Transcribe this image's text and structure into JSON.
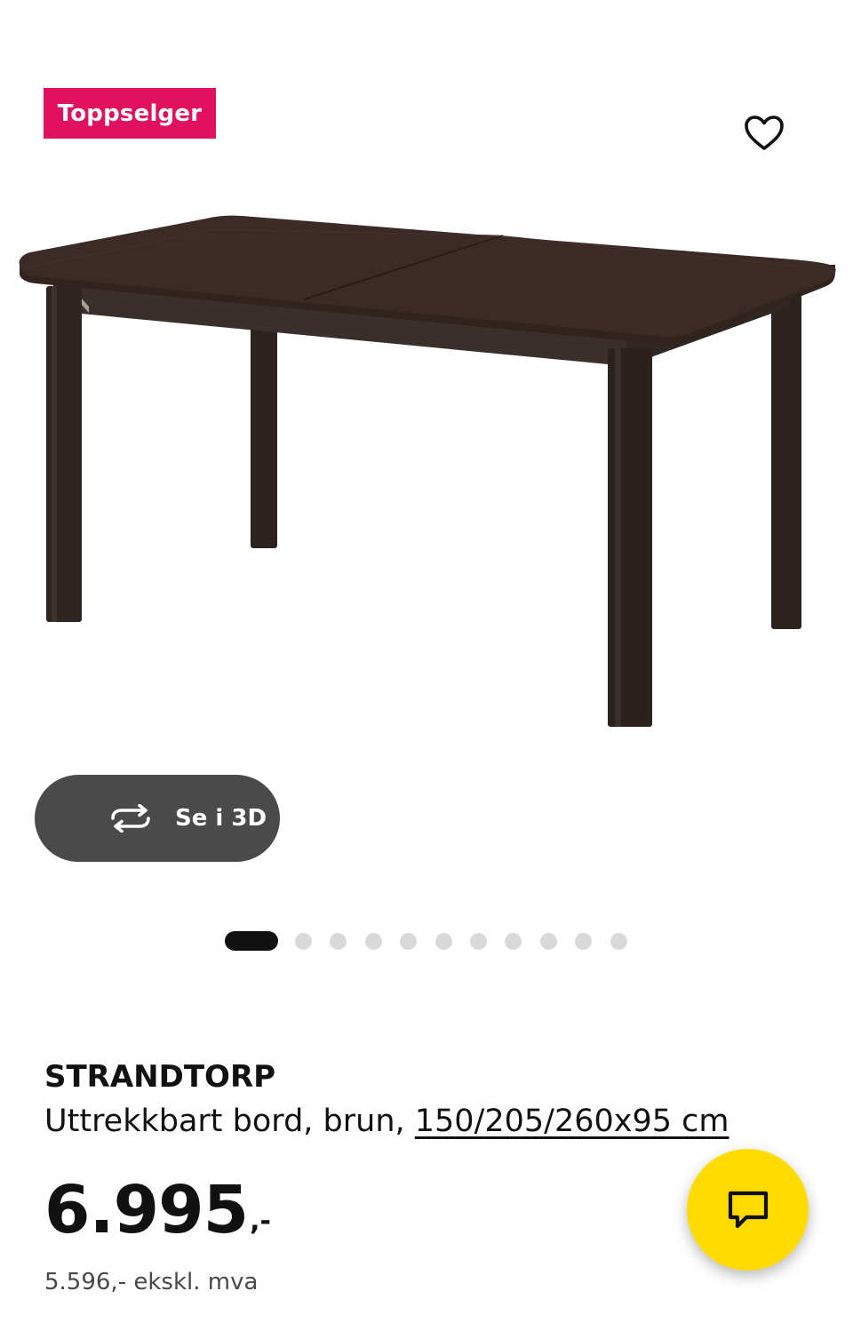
{
  "badge": {
    "label": "Toppselger",
    "color": "#e0115f"
  },
  "favorite": {
    "icon": "heart-outline-icon"
  },
  "product_image": {
    "alt": "STRANDTORP"
  },
  "view_3d": {
    "label": "Se i 3D",
    "icon": "rotate-arrows-icon"
  },
  "carousel": {
    "total": 11,
    "active_index": 0
  },
  "product": {
    "name": "STRANDTORP",
    "description": "Uttrekkbart bord, brun, ",
    "size": "150/205/260x95 cm"
  },
  "price": {
    "amount": "6.995",
    "suffix": ",-",
    "ex_vat": "5.596,- ekskl. mva"
  },
  "chat": {
    "icon": "chat-bubble-icon",
    "color": "#ffdb00"
  }
}
